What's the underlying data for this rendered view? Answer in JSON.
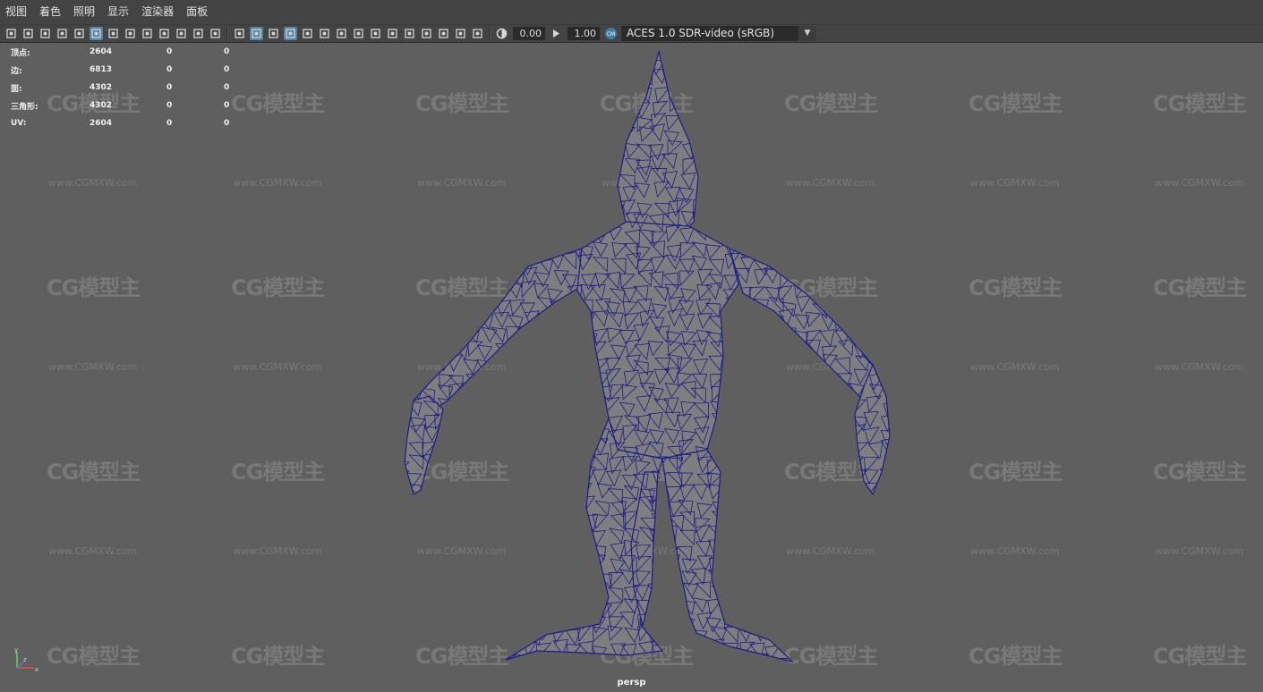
{
  "menu": [
    "视图",
    "着色",
    "照明",
    "显示",
    "渲染器",
    "面板"
  ],
  "toolbar": {
    "icons_left": [
      "camera-select-icon",
      "camera-attributes-icon",
      "bookmark-icon",
      "image-plane-icon",
      "2d-pan-zoom-icon",
      "grease-pencil-icon",
      "grid-icon",
      "film-gate-icon",
      "resolution-gate-icon",
      "gate-mask-icon",
      "field-chart-icon",
      "safe-action-icon",
      "safe-title-icon"
    ],
    "icons_shading": [
      "wireframe-icon",
      "smooth-shade-all-icon",
      "use-default-material-icon",
      "wireframe-on-shaded-icon",
      "xray-icon",
      "use-all-lights-icon",
      "shadows-icon",
      "screen-space-ao-icon",
      "motion-blur-icon",
      "multisample-aa-icon",
      "depth-of-field-icon",
      "isolate-select-icon",
      "xray-joints-icon",
      "xray-active-components-icon",
      "backface-culling-icon"
    ],
    "exposure": "0.00",
    "gamma": "1.00",
    "colorspace": "ACES 1.0 SDR-video (sRGB)"
  },
  "hud": {
    "rows": [
      {
        "label": "顶点:",
        "value": "2604",
        "selected": "0",
        "uv": "0"
      },
      {
        "label": "边:",
        "value": "6813",
        "selected": "0",
        "uv": "0"
      },
      {
        "label": "面:",
        "value": "4302",
        "selected": "0",
        "uv": "0"
      },
      {
        "label": "三角形:",
        "value": "4302",
        "selected": "0",
        "uv": "0"
      },
      {
        "label": "UV:",
        "value": "2604",
        "selected": "0",
        "uv": "0"
      }
    ]
  },
  "watermark": {
    "logo": "CG模型主",
    "url": "www.CGMXW.com"
  },
  "viewport": {
    "camera": "persp",
    "wire_color": "#1c1c8a",
    "mesh_fill": "#7e7e7e"
  },
  "axis": {
    "x": "x",
    "y": "y",
    "z": "z"
  }
}
